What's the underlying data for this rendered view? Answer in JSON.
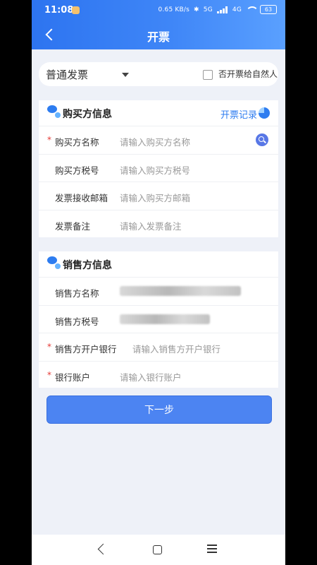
{
  "status_bar": {
    "time": "11:08",
    "network": "0.65 KB/s",
    "signal": "5G",
    "signal2": "4G",
    "battery": "63"
  },
  "header": {
    "title": "开票"
  },
  "invoice_type": {
    "selected": "普通发票",
    "natural_person_label": "否开票给自然人"
  },
  "buyer": {
    "title": "购买方信息",
    "history_link": "开票记录",
    "fields": [
      {
        "label": "购买方名称",
        "placeholder": "请输入购买方名称",
        "required": "*"
      },
      {
        "label": "购买方税号",
        "placeholder": "请输入购买方税号"
      },
      {
        "label": "发票接收邮箱",
        "placeholder": "请输入购买方邮箱"
      },
      {
        "label": "发票备注",
        "placeholder": "请输入发票备注"
      }
    ]
  },
  "seller": {
    "title": "销售方信息",
    "fields": [
      {
        "label": "销售方名称"
      },
      {
        "label": "销售方税号"
      },
      {
        "label": "销售方开户银行",
        "placeholder": "请输入销售方开户银行",
        "required": "*"
      },
      {
        "label": "银行账户",
        "placeholder": "请输入银行账户",
        "required": "*"
      }
    ]
  },
  "next_button": {
    "label": "下一步"
  },
  "colors": {
    "primary": "#2d7cf0",
    "button": "#4c84f2",
    "background": "#eef1f8",
    "required": "#e53935"
  },
  "icons": [
    "back-arrow-icon",
    "dropdown-caret-icon",
    "checkbox",
    "bubble-icon",
    "pie-chart-icon",
    "search-icon"
  ]
}
